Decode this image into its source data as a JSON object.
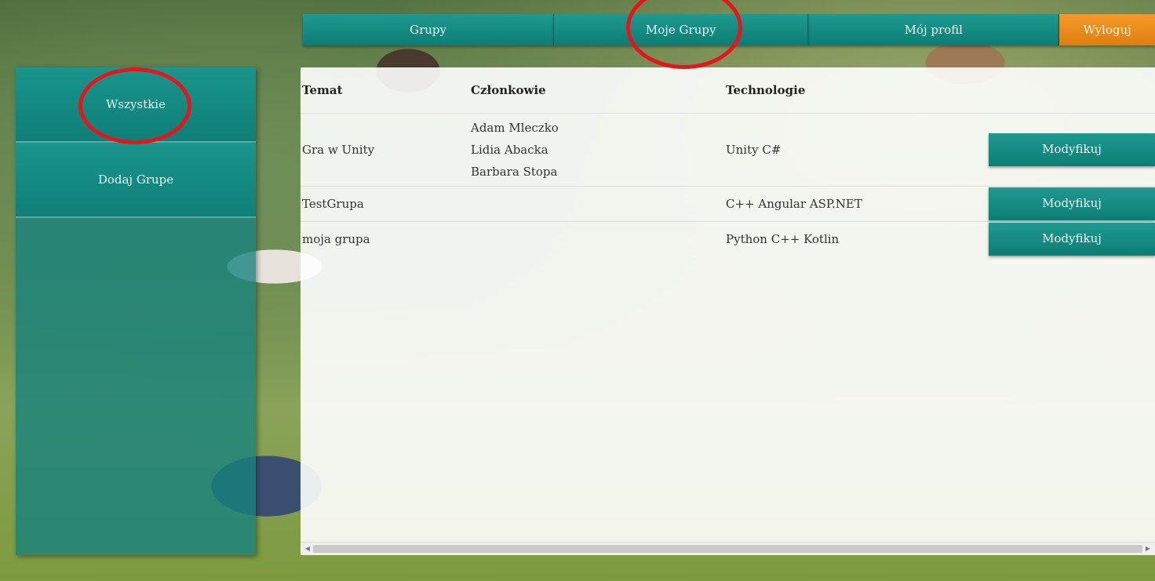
{
  "nav": {
    "tabs": [
      "Grupy",
      "Moje Grupy",
      "Mój profil"
    ],
    "logout": "Wyloguj"
  },
  "sidebar": {
    "items": [
      "Wszystkie",
      "Dodaj Grupe"
    ]
  },
  "table": {
    "headers": [
      "Temat",
      "Członkowie",
      "Technologie"
    ],
    "rows": [
      {
        "topic": "Gra w Unity",
        "members": [
          "Adam Mleczko",
          "Lidia Abacka",
          "Barbara Stopa"
        ],
        "tech": "Unity C#",
        "action": "Modyfikuj"
      },
      {
        "topic": "TestGrupa",
        "members": [],
        "tech": "C++ Angular ASP.NET",
        "action": "Modyfikuj"
      },
      {
        "topic": "moja grupa",
        "members": [],
        "tech": "Python C++ Kotlin",
        "action": "Modyfikuj"
      }
    ]
  },
  "scrollbar": {
    "left_arrow": "◀",
    "right_arrow": "▶"
  },
  "colors": {
    "teal": "#0d7d74",
    "orange": "#e07e10",
    "highlight_circle": "#e8141b"
  }
}
